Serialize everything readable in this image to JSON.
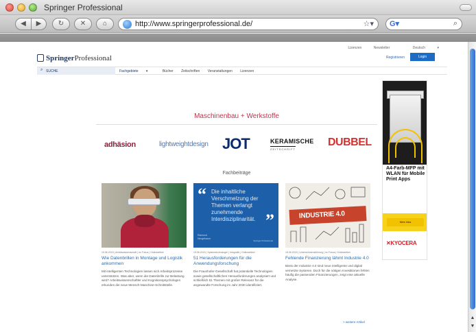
{
  "window": {
    "title": "Springer Professional",
    "url": "http://www.springerprofessional.de/"
  },
  "header": {
    "util_links": [
      "Lizenzen",
      "Newsletter",
      "Deutsch"
    ],
    "logo_bold": "Springer",
    "logo_rest": "Professional",
    "register": "Registrieren",
    "login": "Login"
  },
  "nav": {
    "search_label": "SUCHE",
    "items": [
      "Fachgebiete",
      "Bücher",
      "Zeitschriften",
      "Veranstaltungen",
      "Lizenzen"
    ]
  },
  "section": {
    "title": "Maschinenbau + Werkstoffe",
    "sub_heading": "Fachbeiträge",
    "more_link": "> weitere Artikel"
  },
  "brands": {
    "adhaesion": "adhäsion",
    "lightweight": "lightweightdesign",
    "jot": "JOT",
    "keramische": "KERAMISCHE",
    "keramische_sub": "ZEITSCHRIFT",
    "dubbel": "DUBBEL"
  },
  "articles": [
    {
      "meta": "15.06.2015 | Arbeitswissenschaft | Im Fokus | Onlineartikel",
      "title": "Wie Datenbrillen in Montage und Logistik ankommen",
      "body": "Mit intelligenten Technologien lassen sich Arbeitsprozesse unterstützen. Was aber, wenn die Datenbrille zur Belastung wird? Arbeitswissenschaftler und Kognitionspsychologen erkunden die neue Mensch-Maschine-Schnittstelle."
    },
    {
      "meta": "15.06.2015 | Systemtechnologie | Infografik | Onlineartikel",
      "title": "51 Herausforderungen für die Anwendungsforschung",
      "body": "Die Fraunhofer-Gesellschaft hat potentielle Technologien sowie gesellschaftlichen Herausforderungen analysiert und schließlich 51 Themen mit großer Relevanz für die angewandte Forschung im Jahr 2030 identifiziert.",
      "quote": "Die inhaltliche Verschmelzung der Themen verlangt zunehmende Interdisziplinarität.",
      "author": "Raimund\nNeugebauer",
      "brandline": "Springer Professional"
    },
    {
      "meta": "15.06.2015 | Unternehmensführung | Im Fokus | Onlineartikel",
      "title": "Fehlende Finanzierung lähmt Industrie 4.0",
      "body": "Bisss der Industrie 4.0 sind neue intelligente und digital vernetzte Systeme. Doch für die nötigen Investitionen fehlen häufig die passenden Finanzierungen, zeigt eine aktuelle Analyse.",
      "banner": "INDUSTRIE 4.0"
    }
  ],
  "ad": {
    "headline": "A4-Farb-MFP mit WLAN für Mobile Print Apps",
    "cta": "Mehr Infos",
    "brand": "KYOCERA"
  },
  "colors": {
    "accent_red": "#c4304a",
    "link_blue": "#2b6cb0",
    "login_blue": "#1d6cc4",
    "kyocera_red": "#d1202c"
  }
}
